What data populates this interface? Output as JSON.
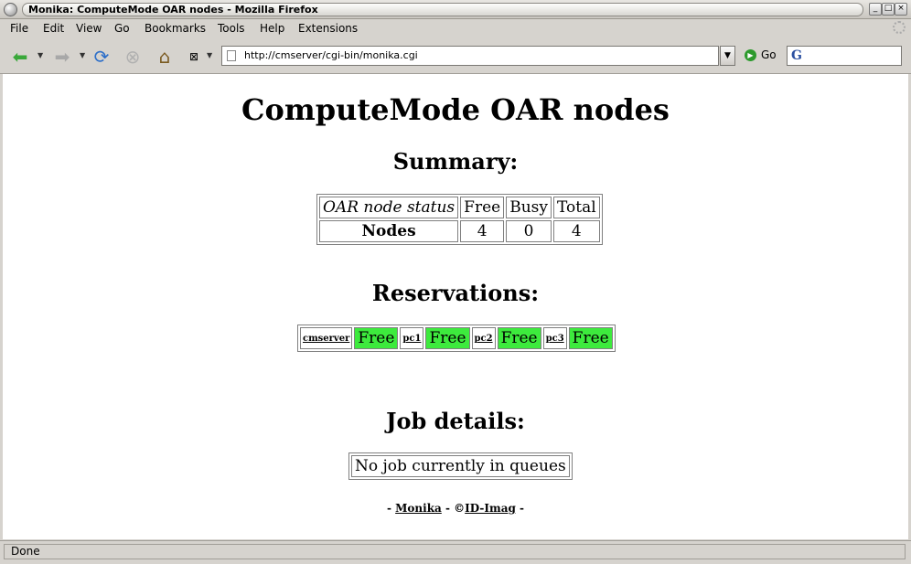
{
  "window": {
    "title": "Monika: ComputeMode OAR nodes - Mozilla Firefox"
  },
  "menu": [
    "File",
    "Edit",
    "View",
    "Go",
    "Bookmarks",
    "Tools",
    "Help",
    "Extensions"
  ],
  "toolbar": {
    "url": "http://cmserver/cgi-bin/monika.cgi",
    "go_label": "Go",
    "search_value": ""
  },
  "page": {
    "title": "ComputeMode OAR nodes",
    "summary_heading": "Summary:",
    "summary": {
      "headers": [
        "OAR node status",
        "Free",
        "Busy",
        "Total"
      ],
      "row_label": "Nodes",
      "values": [
        "4",
        "0",
        "4"
      ]
    },
    "reservations_heading": "Reservations:",
    "reservations": [
      {
        "host": "cmserver",
        "state": "Free"
      },
      {
        "host": "pc1",
        "state": "Free"
      },
      {
        "host": "pc2",
        "state": "Free"
      },
      {
        "host": "pc3",
        "state": "Free"
      }
    ],
    "jobs_heading": "Job details:",
    "jobs_message": "No job currently in queues",
    "footer": {
      "prefix": "- ",
      "link1": "Monika",
      "sep": " - ©",
      "link2": "ID-Imag",
      "suffix": " -"
    }
  },
  "status": {
    "text": "Done"
  },
  "colors": {
    "free": "#3dea3d"
  }
}
